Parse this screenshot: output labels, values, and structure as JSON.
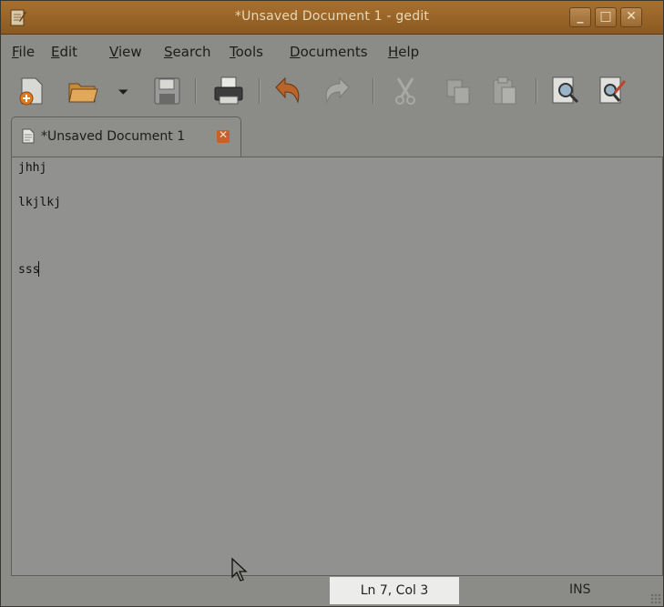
{
  "window": {
    "title": "*Unsaved Document 1 - gedit",
    "controls": {
      "minimize": "_",
      "maximize": "□",
      "close": "✕"
    }
  },
  "menubar": {
    "items": [
      {
        "pre": "",
        "key": "F",
        "rest": "ile"
      },
      {
        "pre": "",
        "key": "E",
        "rest": "dit"
      },
      {
        "pre": "",
        "key": "V",
        "rest": "iew"
      },
      {
        "pre": "",
        "key": "S",
        "rest": "earch"
      },
      {
        "pre": "",
        "key": "T",
        "rest": "ools"
      },
      {
        "pre": "",
        "key": "D",
        "rest": "ocuments"
      },
      {
        "pre": "",
        "key": "H",
        "rest": "elp"
      }
    ]
  },
  "toolbar": {
    "icons": [
      "new-document-icon",
      "open-folder-icon",
      "open-recent-dropdown-icon",
      "save-icon",
      "print-icon",
      "undo-icon",
      "redo-icon",
      "cut-icon",
      "copy-icon",
      "paste-icon",
      "find-icon",
      "find-replace-icon"
    ]
  },
  "tab": {
    "label": "*Unsaved Document 1",
    "close": "✕"
  },
  "editor": {
    "lines": [
      "jhhj",
      "",
      "lkjlkj",
      "",
      "",
      "",
      "sss"
    ]
  },
  "status": {
    "position": "Ln 7, Col 3",
    "mode": "INS"
  }
}
